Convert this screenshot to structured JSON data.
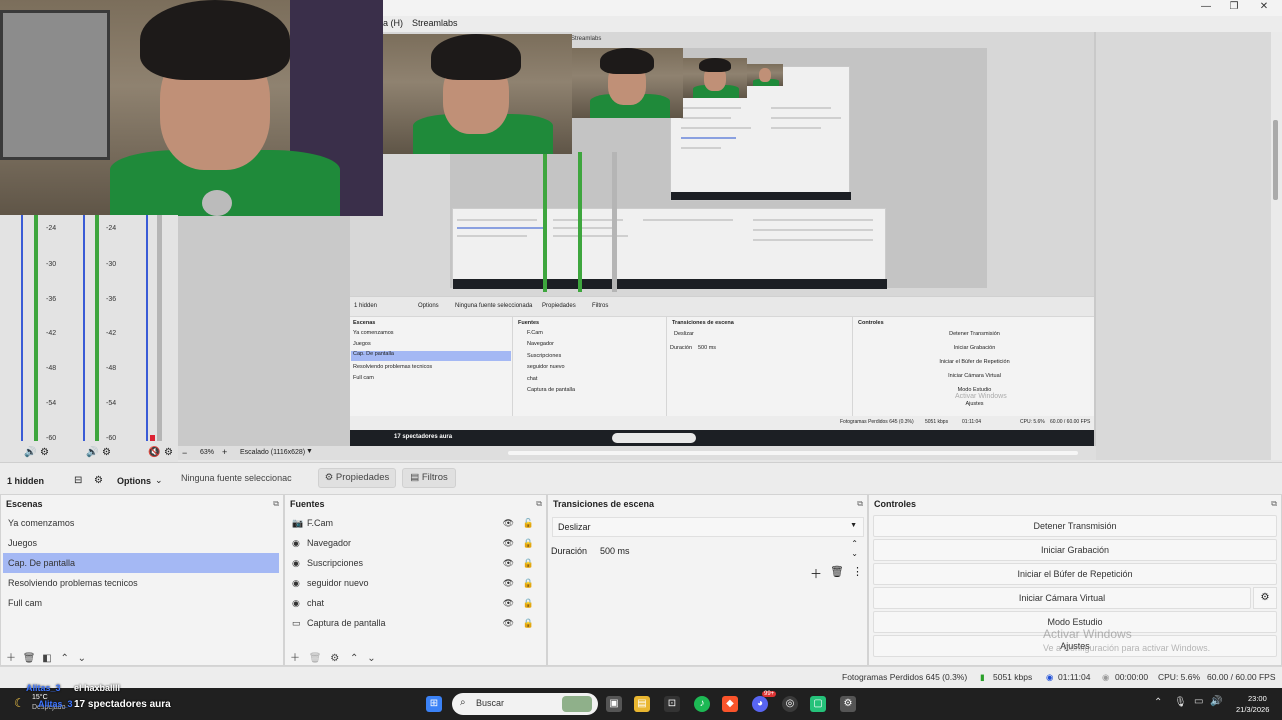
{
  "menubar": {
    "items": [
      "a (H)",
      "Streamlabs"
    ]
  },
  "window_controls": {
    "minimize": "—",
    "restore": "❐",
    "close": "✕"
  },
  "mixer": {
    "ticks": [
      "-24",
      "-30",
      "-36",
      "-42",
      "-48",
      "-54",
      "-60"
    ]
  },
  "preview_controls": {
    "zoom": "63%",
    "scaling": "Escalado (1116x628)"
  },
  "nested": {
    "menu": "Streamlabs",
    "hidden": "1 hidden",
    "options": "Options",
    "no_source": "Ninguna fuente seleccionada",
    "props": "Propiedades",
    "filters": "Filtros",
    "scenes_title": "Escenas",
    "sources_title": "Fuentes",
    "transitions_title": "Transiciones de escena",
    "controls_title": "Controles",
    "scenes": [
      "Ya comenzamos",
      "Juegos",
      "Cap. De pantalla",
      "Resolviendo problemas tecnicos",
      "Full cam"
    ],
    "sources": [
      "F.Cam",
      "Navegador",
      "Suscripciones",
      "seguidor nuevo",
      "chat",
      "Captura de pantalla"
    ],
    "transition": "Deslizar",
    "duration_label": "Duración",
    "duration": "500 ms",
    "controls": [
      "Detener Transmisión",
      "Iniciar Grabación",
      "Iniciar el Búfer de Repetición",
      "Iniciar Cámara Virtual",
      "Modo Estudio",
      "Ajustes"
    ],
    "watermark": "Activar Windows",
    "status": "Fotogramas Perdidos 645 (0.3%)",
    "kbps": "5051 kbps",
    "time": "01:11:04",
    "cpu": "CPU: 5.6%",
    "fps": "60.00 / 60.00 FPS",
    "overlay_line": "17 spectadores aura"
  },
  "toolbar": {
    "hidden_label": "1 hidden",
    "options_label": "Options",
    "no_source": "Ninguna fuente seleccionac",
    "properties": "Propiedades",
    "filters": "Filtros"
  },
  "scenes": {
    "title": "Escenas",
    "items": [
      "Ya comenzamos",
      "Juegos",
      "Cap. De pantalla",
      "Resolviendo problemas tecnicos",
      "Full cam"
    ],
    "selected_index": 2
  },
  "sources": {
    "title": "Fuentes",
    "items": [
      {
        "label": "F.Cam",
        "icon": "camera-icon"
      },
      {
        "label": "Navegador",
        "icon": "globe-icon"
      },
      {
        "label": "Suscripciones",
        "icon": "globe-icon"
      },
      {
        "label": "seguidor nuevo",
        "icon": "globe-icon"
      },
      {
        "label": "chat",
        "icon": "globe-icon"
      },
      {
        "label": "Captura de pantalla",
        "icon": "monitor-icon"
      }
    ]
  },
  "transitions": {
    "title": "Transiciones de escena",
    "selected": "Deslizar",
    "duration_label": "Duración",
    "duration_value": "500 ms"
  },
  "controls": {
    "title": "Controles",
    "buttons": [
      "Detener Transmisión",
      "Iniciar Grabación",
      "Iniciar el Búfer de Repetición",
      "Iniciar Cámara Virtual",
      "Modo Estudio",
      "Ajustes"
    ]
  },
  "activation": {
    "title": "Activar Windows",
    "subtitle": "Ve a Configuración para activar Windows."
  },
  "status": {
    "dropped": "Fotogramas Perdidos 645 (0.3%)",
    "bitrate": "5051 kbps",
    "stream_time": "01:11:04",
    "rec_time": "00:00:00",
    "cpu": "CPU: 5.6%",
    "fps": "60.00 / 60.00 FPS"
  },
  "overlay": {
    "line1_name": "Alitas_3",
    "line1_text": "el haxballll",
    "line2_name": "Alitas_3",
    "line2_text": "17 spectadores aura",
    "weather_temp": "15°C",
    "weather_desc": "Despejado"
  },
  "taskbar": {
    "search_placeholder": "Buscar",
    "time": "23:00",
    "date": "21/3/2026",
    "badge": "99+"
  },
  "colors": {
    "selected": "#a4b8f4",
    "meter": "#3ea63e",
    "taskbar": "#202020"
  }
}
